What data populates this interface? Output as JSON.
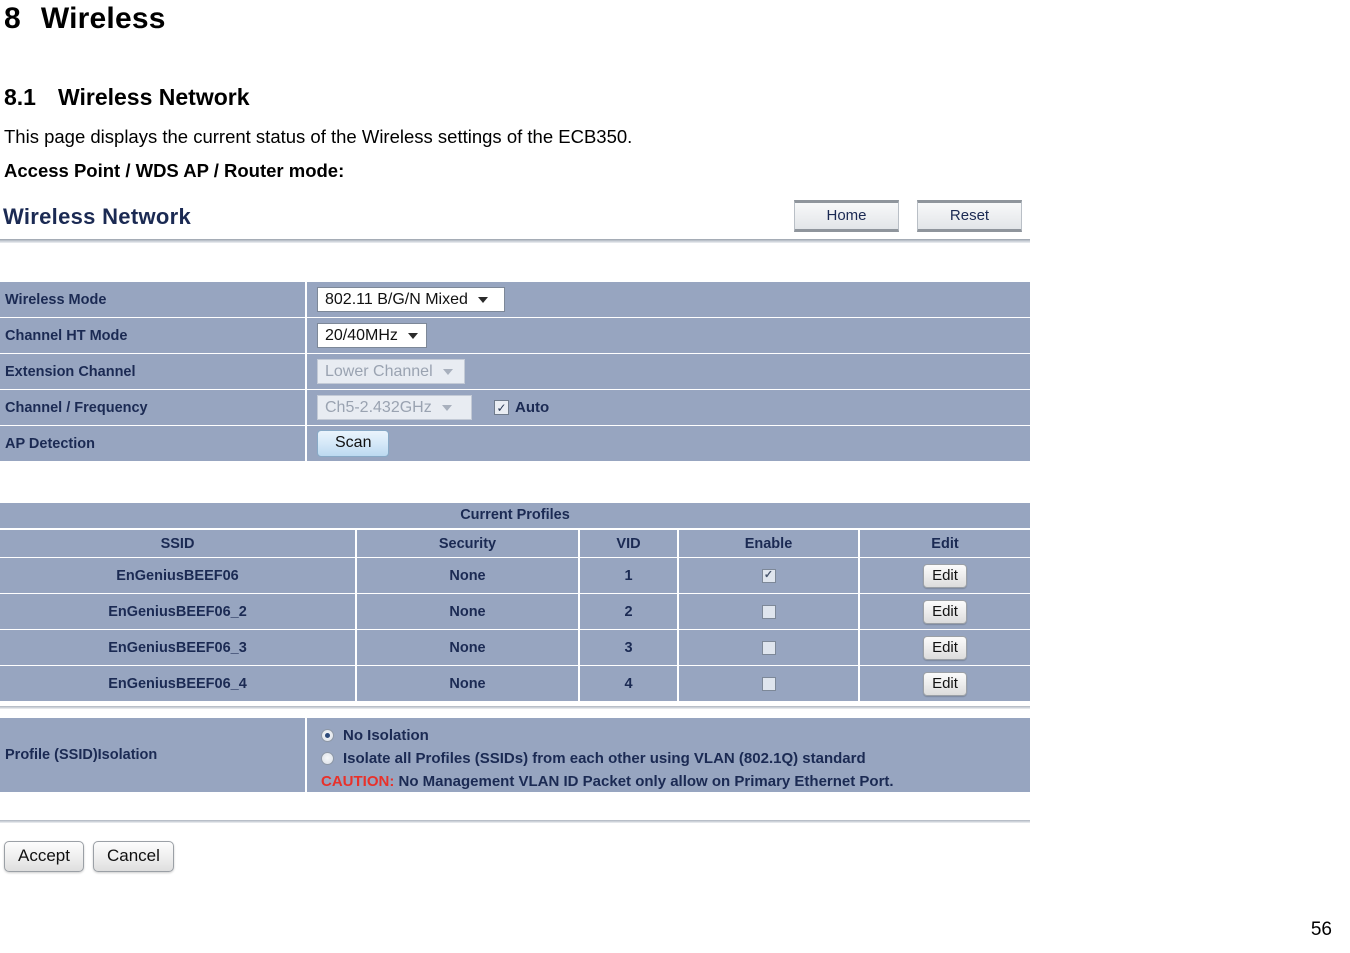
{
  "document": {
    "chapter_number": "8",
    "chapter_title": "Wireless",
    "section_number": "8.1",
    "section_title": "Wireless Network",
    "intro_paragraph": "This page displays the current status of the Wireless settings of the ECB350.",
    "mode_caption": "Access Point / WDS AP / Router mode:",
    "page_number": "56"
  },
  "panel": {
    "title": "Wireless Network",
    "buttons": {
      "home": "Home",
      "reset": "Reset"
    }
  },
  "settings": {
    "rows": [
      {
        "label": "Wireless Mode",
        "value": "802.11 B/G/N Mixed",
        "control": "select",
        "disabled": false
      },
      {
        "label": "Channel HT Mode",
        "value": "20/40MHz",
        "control": "select",
        "disabled": false
      },
      {
        "label": "Extension Channel",
        "value": "Lower Channel",
        "control": "select",
        "disabled": true
      },
      {
        "label": "Channel / Frequency",
        "value": "Ch5-2.432GHz",
        "control": "select",
        "disabled": true
      },
      {
        "label": "AP Detection",
        "value": "Scan",
        "control": "button",
        "disabled": false
      }
    ],
    "auto_checkbox": {
      "label": "Auto",
      "checked": true,
      "mark": "✓"
    }
  },
  "profiles": {
    "title": "Current Profiles",
    "columns": [
      "SSID",
      "Security",
      "VID",
      "Enable",
      "Edit"
    ],
    "edit_label": "Edit",
    "check_mark": "✓",
    "rows": [
      {
        "ssid": "EnGeniusBEEF06",
        "security": "None",
        "vid": "1",
        "enabled": true,
        "edit": "Edit"
      },
      {
        "ssid": "EnGeniusBEEF06_2",
        "security": "None",
        "vid": "2",
        "enabled": false,
        "edit": "Edit"
      },
      {
        "ssid": "EnGeniusBEEF06_3",
        "security": "None",
        "vid": "3",
        "enabled": false,
        "edit": "Edit"
      },
      {
        "ssid": "EnGeniusBEEF06_4",
        "security": "None",
        "vid": "4",
        "enabled": false,
        "edit": "Edit"
      }
    ]
  },
  "isolation": {
    "label": "Profile (SSID)Isolation",
    "options": [
      {
        "text": "No Isolation",
        "selected": true
      },
      {
        "text": "Isolate all Profiles (SSIDs) from each other using VLAN (802.1Q) standard",
        "selected": false
      }
    ],
    "caution_word": "CAUTION:",
    "caution_text": " No Management VLAN ID Packet only allow on Primary Ethernet Port."
  },
  "footer": {
    "accept": "Accept",
    "cancel": "Cancel"
  },
  "colors": {
    "table_blue": "#97a5c0",
    "text_navy": "#1b2a53",
    "caution_red": "#e8312a"
  }
}
